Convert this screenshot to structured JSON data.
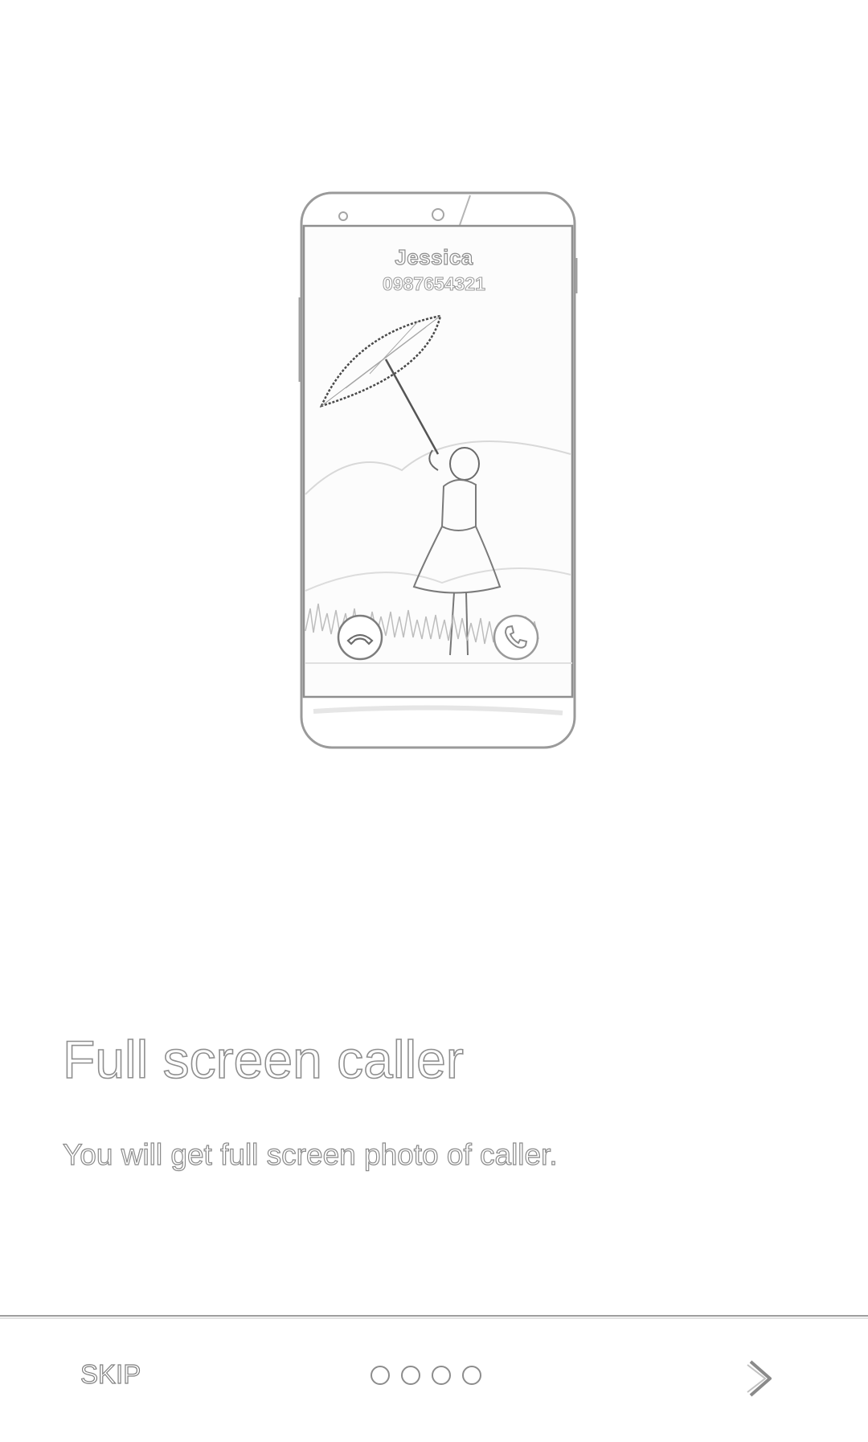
{
  "illustration": {
    "caller_name": "Jessica",
    "caller_number": "0987654321"
  },
  "intro": {
    "title": "Full screen caller",
    "description": "You will get full screen photo of caller."
  },
  "footer": {
    "skip_label": "SKIP",
    "page_indicator": {
      "total": 4,
      "current": 1
    },
    "next_icon": "chevron-right-icon"
  },
  "colors": {
    "background": "#ffffff",
    "outline": "#8c8c8c",
    "divider": "#9d9d9d"
  }
}
